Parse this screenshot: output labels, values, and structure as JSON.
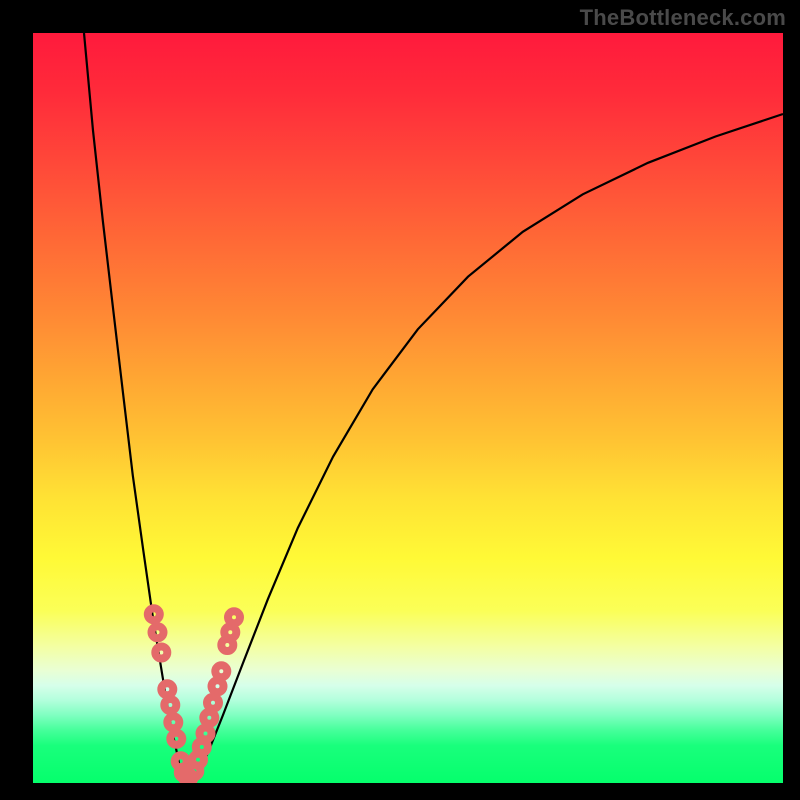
{
  "watermark": "TheBottleneck.com",
  "chart_data": {
    "type": "line",
    "title": "",
    "xlabel": "",
    "ylabel": "",
    "xlim": [
      0,
      100
    ],
    "ylim": [
      0,
      100
    ],
    "grid": false,
    "background_gradient": {
      "top": "#ff1a3c",
      "mid_upper": "#ff8a34",
      "mid_lower": "#fff936",
      "band": "#f3ffa6",
      "bottom": "#05ff6c"
    },
    "series": [
      {
        "name": "left-branch",
        "stroke": "#000000",
        "x": [
          6.8,
          8.0,
          9.3,
          10.7,
          12.0,
          13.3,
          14.7,
          16.0,
          17.3,
          18.3,
          19.2,
          19.7,
          20.0
        ],
        "y": [
          100,
          87,
          75,
          63,
          52,
          41,
          31,
          22,
          14,
          8,
          4,
          1.5,
          0.5
        ]
      },
      {
        "name": "right-branch",
        "stroke": "#000000",
        "x": [
          21.0,
          22.0,
          23.3,
          25.3,
          28.0,
          31.3,
          35.3,
          40.0,
          45.3,
          51.3,
          58.0,
          65.3,
          73.3,
          82.0,
          91.0,
          100
        ],
        "y": [
          0.5,
          1.5,
          4,
          9,
          16,
          24.5,
          34,
          43.5,
          52.5,
          60.5,
          67.5,
          73.5,
          78.5,
          82.7,
          86.2,
          89.2
        ]
      }
    ],
    "markers": {
      "name": "highlight-dots",
      "stroke": "#e46a6a",
      "stroke_width": 8,
      "points": [
        {
          "x": 16.1,
          "y": 22.5
        },
        {
          "x": 16.6,
          "y": 20.1
        },
        {
          "x": 17.1,
          "y": 17.4
        },
        {
          "x": 17.9,
          "y": 12.5
        },
        {
          "x": 18.3,
          "y": 10.4
        },
        {
          "x": 18.7,
          "y": 8.1
        },
        {
          "x": 19.1,
          "y": 5.9
        },
        {
          "x": 19.7,
          "y": 2.9
        },
        {
          "x": 20.1,
          "y": 1.4
        },
        {
          "x": 20.7,
          "y": 0.7
        },
        {
          "x": 21.5,
          "y": 1.6
        },
        {
          "x": 22.0,
          "y": 3.1
        },
        {
          "x": 22.5,
          "y": 4.8
        },
        {
          "x": 23.0,
          "y": 6.6
        },
        {
          "x": 23.5,
          "y": 8.7
        },
        {
          "x": 24.0,
          "y": 10.7
        },
        {
          "x": 24.6,
          "y": 12.9
        },
        {
          "x": 25.1,
          "y": 14.9
        },
        {
          "x": 25.9,
          "y": 18.4
        },
        {
          "x": 26.3,
          "y": 20.1
        },
        {
          "x": 26.8,
          "y": 22.1
        }
      ]
    }
  }
}
